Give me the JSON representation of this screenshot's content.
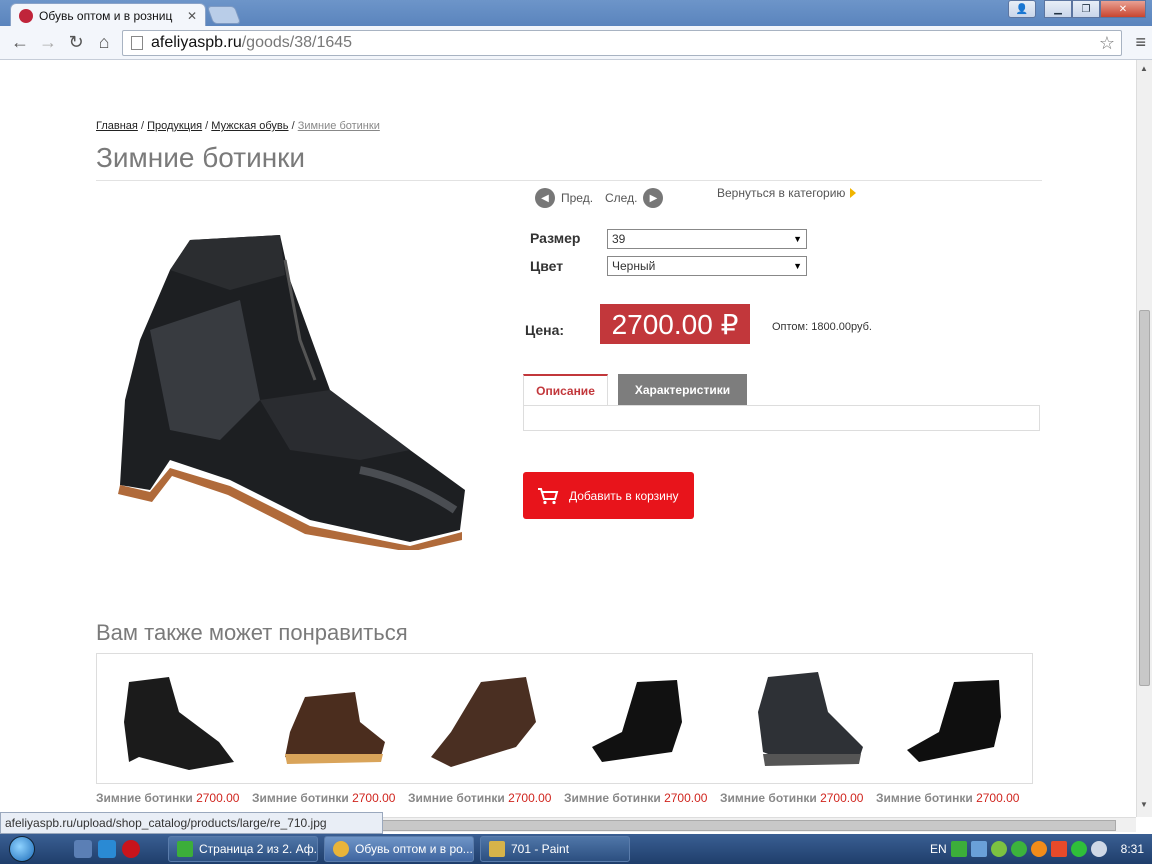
{
  "browser": {
    "tab_title": "Обувь оптом и в розниц",
    "tab_close": "✕",
    "url_host": "afeliyaspb.ru",
    "url_path": "/goods/38/1645",
    "win_buttons": {
      "minimize": "▁",
      "maximize": "❐",
      "close": "✕",
      "user": "👤"
    },
    "nav": {
      "back": "←",
      "forward": "→",
      "reload": "↻",
      "home": "⌂",
      "star": "☆",
      "menu": "≡"
    },
    "status_url": "afeliyaspb.ru/upload/shop_catalog/products/large/re_710.jpg"
  },
  "breadcrumb": [
    {
      "label": "Главная"
    },
    {
      "label": "Продукция"
    },
    {
      "label": "Мужская обувь"
    },
    {
      "label": "Зимние ботинки"
    }
  ],
  "breadcrumb_sep": "/",
  "product": {
    "title": "Зимние ботинки",
    "prev_label": "Пред.",
    "next_label": "След.",
    "back_to_category": "Вернуться в категорию",
    "size_label": "Размер",
    "size_value": "39",
    "color_label": "Цвет",
    "color_value": "Черный",
    "price_label": "Цена:",
    "price": "2700.00 ₽",
    "wholesale": "Оптом: 1800.00руб.",
    "tabs": [
      {
        "label": "Описание",
        "active": true
      },
      {
        "label": "Характеристики",
        "active": false
      }
    ],
    "add_to_cart": "Добавить в корзину"
  },
  "related": {
    "title": "Вам также может понравиться",
    "items": [
      {
        "name": "Зимние ботинки",
        "price": "2700.00"
      },
      {
        "name": "Зимние ботинки",
        "price": "2700.00"
      },
      {
        "name": "Зимние ботинки",
        "price": "2700.00"
      },
      {
        "name": "Зимние ботинки",
        "price": "2700.00"
      },
      {
        "name": "Зимние ботинки",
        "price": "2700.00"
      },
      {
        "name": "Зимние ботинки",
        "price": "2700.00"
      }
    ]
  },
  "taskbar": {
    "tasks": [
      {
        "label": "Страница 2 из 2. Аф..."
      },
      {
        "label": "Обувь оптом и в ро..."
      },
      {
        "label": "701 - Paint"
      }
    ],
    "lang": "EN",
    "time": "8:31"
  },
  "colors": {
    "accent_red": "#c2373b",
    "cart_red": "#e8141b",
    "price_red": "#d0261f",
    "tab_gray": "#7d7d7d"
  }
}
